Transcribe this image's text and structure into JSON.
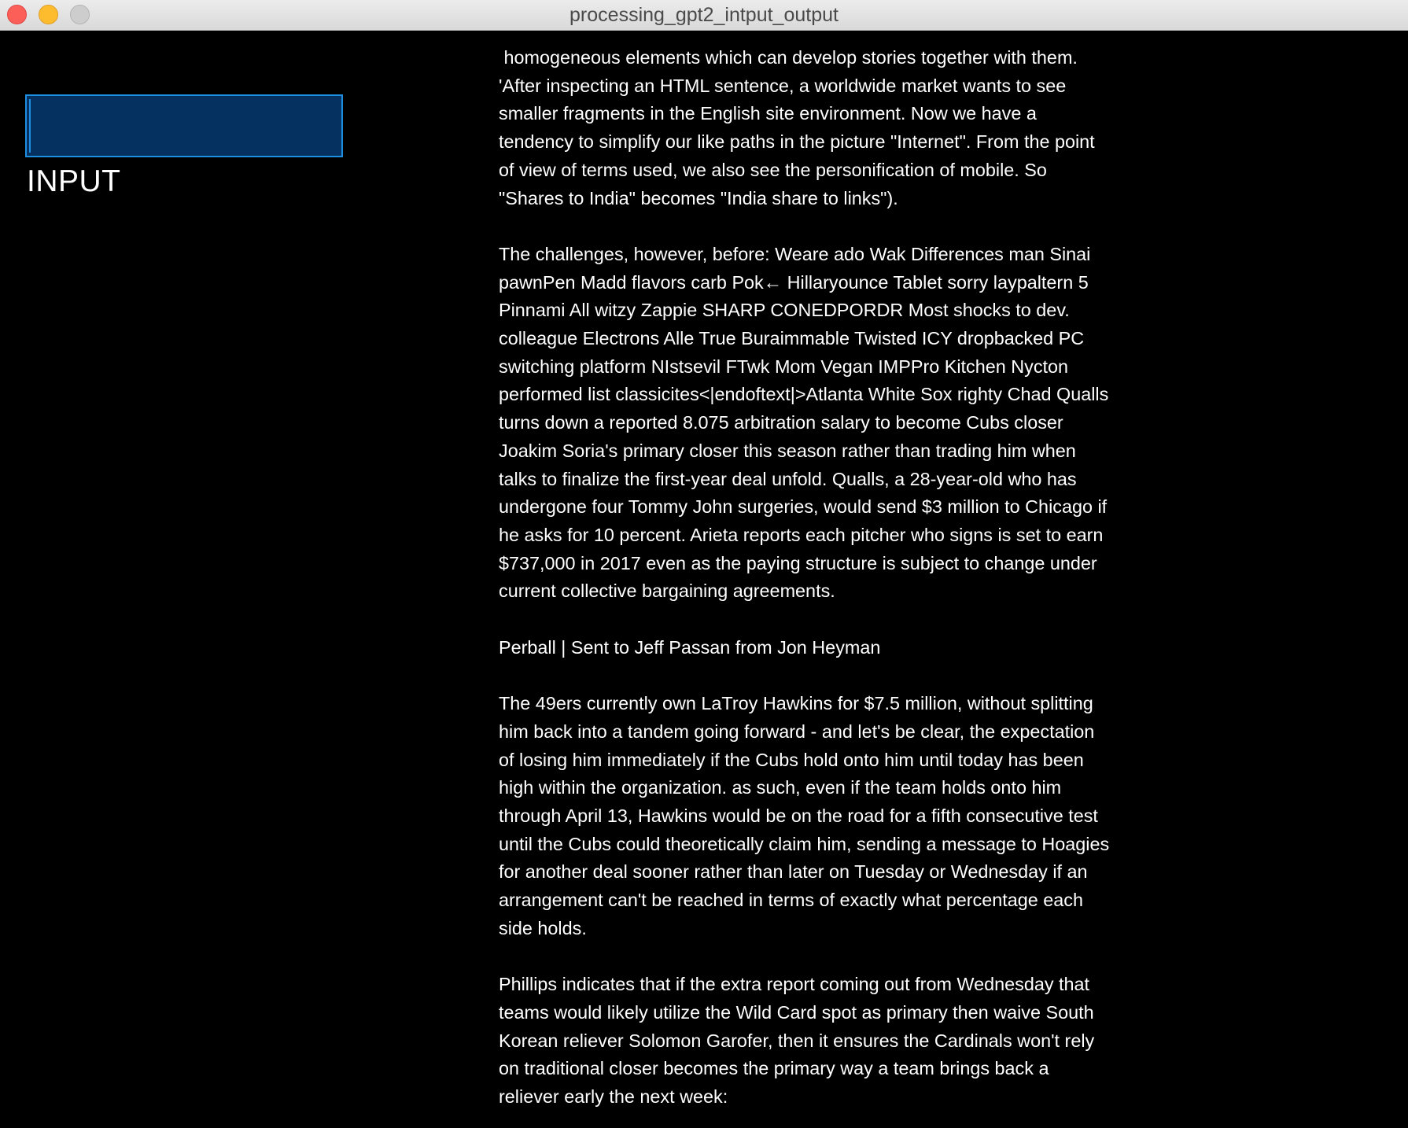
{
  "window": {
    "title": "processing_gpt2_intput_output"
  },
  "input": {
    "value": "",
    "label": "INPUT"
  },
  "output": {
    "paragraphs": [
      [
        " homogeneous elements which can develop stories together with them.",
        "'After inspecting an HTML sentence, a worldwide market wants to see",
        "smaller fragments in the English site environment. Now we have a",
        "tendency to simplify our like paths in the picture \"Internet\". From the point",
        "of view of terms used, we also see the personification of mobile. So",
        "\"Shares to India\" becomes \"India share to links\")."
      ],
      [
        "The challenges, however, before: Weare ado Wak Differences man Sinai",
        "pawnPen Madd flavors carb Pok← Hillaryounce Tablet sorry laypaltern 5",
        "Pinnami All witzy Zappie SHARP CONEDPORDR Most shocks to dev.",
        "colleague Electrons Alle True Buraimmable Twisted ICY dropbacked PC",
        "switching platform NIstsevil FTwk Mom Vegan IMPPro Kitchen Nycton",
        "performed list classicites<|endoftext|>Atlanta White Sox righty Chad Qualls",
        "turns down a reported 8.075 arbitration salary to become Cubs closer",
        "Joakim Soria's primary closer this season rather than trading him when",
        "talks to finalize the first-year deal unfold. Qualls, a 28-year-old who has",
        "undergone four Tommy John surgeries, would send $3 million to Chicago if",
        "he asks for 10 percent. Arieta reports each pitcher who signs is set to earn",
        "$737,000 in 2017 even as the paying structure is subject to change under",
        "current collective bargaining agreements."
      ],
      [
        "Perball | Sent to Jeff Passan from Jon Heyman"
      ],
      [
        "The 49ers currently own LaTroy Hawkins for $7.5 million, without splitting",
        "him back into a tandem going forward - and let's be clear, the expectation",
        "of losing him immediately if the Cubs hold onto him until today has been",
        "high within the organization. as such, even if the team holds onto him",
        "through April 13, Hawkins would be on the road for a fifth consecutive test",
        "until the Cubs could theoretically claim him, sending a message to Hoagies",
        "for another deal sooner rather than later on Tuesday or Wednesday if an",
        "arrangement can't be reached in terms of exactly what percentage each",
        "side holds."
      ],
      [
        "Phillips indicates that if the extra report coming out from Wednesday that",
        "teams would likely utilize the Wild Card spot as primary then waive South",
        "Korean reliever Solomon Garofer, then it ensures the Cardinals won't rely",
        "on traditional closer becomes the primary way a team brings back a",
        "reliever early the next week:"
      ]
    ]
  },
  "colors": {
    "background": "#000000",
    "input_fill": "#04315f",
    "input_border": "#1e8fe0",
    "text": "#ffffff"
  }
}
